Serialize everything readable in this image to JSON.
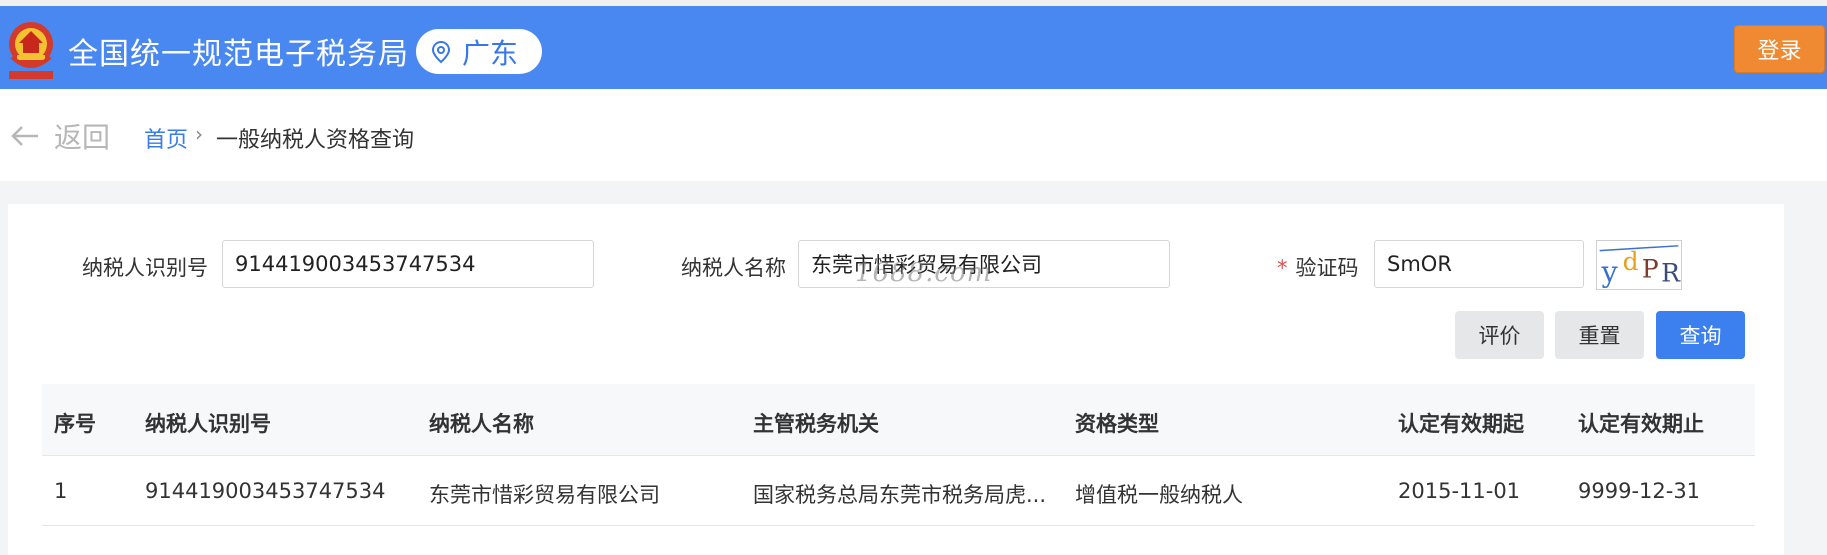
{
  "header": {
    "title": "全国统一规范电子税务局",
    "region": "广东",
    "login_label": "登录",
    "logo_icon": "tax-emblem-icon",
    "brand_color": "#4a88f1"
  },
  "breadcrumb": {
    "back_label": "返回",
    "home": "首页",
    "separator": "›",
    "current": "一般纳税人资格查询"
  },
  "form": {
    "taxpayer_id_label": "纳税人识别号",
    "taxpayer_id_value": "914419003453747534",
    "taxpayer_name_label": "纳税人名称",
    "taxpayer_name_value": "东莞市惜彩贸易有限公司",
    "captcha_label": "验证码",
    "captcha_required_mark": "*",
    "captcha_value": "SmOR",
    "captcha_image_text": "ydPR"
  },
  "buttons": {
    "rate": "评价",
    "reset": "重置",
    "query": "查询"
  },
  "table": {
    "columns": [
      "序号",
      "纳税人识别号",
      "纳税人名称",
      "主管税务机关",
      "资格类型",
      "认定有效期起",
      "认定有效期止"
    ],
    "rows": [
      [
        "1",
        "914419003453747534",
        "东莞市惜彩贸易有限公司",
        "国家税务总局东莞市税务局虎...",
        "增值税一般纳税人",
        "2015-11-01",
        "9999-12-31"
      ]
    ]
  },
  "watermark": "1688.com"
}
